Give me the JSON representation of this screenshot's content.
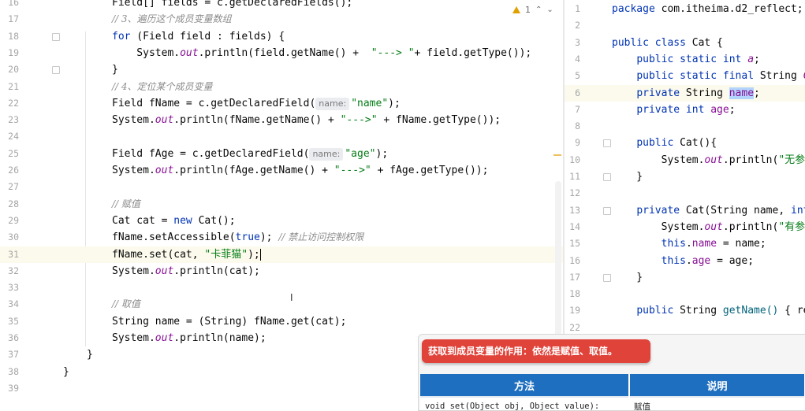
{
  "left_editor": {
    "warning_count": "1",
    "lines": [
      {
        "num": "16",
        "tokens": [
          {
            "t": "Field[] fields = c.getDeclaredFields();",
            "c": ""
          }
        ]
      },
      {
        "num": "17",
        "tokens": [
          {
            "t": "// 3、遍历这个成员变量数组",
            "c": "cm"
          }
        ]
      },
      {
        "num": "18",
        "tokens": [
          {
            "t": "for",
            "c": "kw"
          },
          {
            "t": " (Field field : fields) {",
            "c": ""
          }
        ]
      },
      {
        "num": "19",
        "tokens": [
          {
            "t": "    System.",
            "c": ""
          },
          {
            "t": "out",
            "c": "stat"
          },
          {
            "t": ".println(field.getName() +  ",
            "c": ""
          },
          {
            "t": "\"---> \"",
            "c": "st"
          },
          {
            "t": "+ field.getType());",
            "c": ""
          }
        ]
      },
      {
        "num": "20",
        "tokens": [
          {
            "t": "}",
            "c": ""
          }
        ]
      },
      {
        "num": "21",
        "tokens": [
          {
            "t": "// 4、定位某个成员变量",
            "c": "cm"
          }
        ]
      },
      {
        "num": "22",
        "tokens": [
          {
            "t": "Field fName = c.getDeclaredField(",
            "c": ""
          },
          {
            "t": "name:",
            "c": "hint"
          },
          {
            "t": "\"name\"",
            "c": "st"
          },
          {
            "t": ");",
            "c": ""
          }
        ]
      },
      {
        "num": "23",
        "tokens": [
          {
            "t": "System.",
            "c": ""
          },
          {
            "t": "out",
            "c": "stat"
          },
          {
            "t": ".println(fName.getName() + ",
            "c": ""
          },
          {
            "t": "\"--->\"",
            "c": "st"
          },
          {
            "t": " + fName.getType());",
            "c": ""
          }
        ]
      },
      {
        "num": "24",
        "tokens": []
      },
      {
        "num": "25",
        "tokens": [
          {
            "t": "Field fAge = c.getDeclaredField(",
            "c": ""
          },
          {
            "t": "name:",
            "c": "hint"
          },
          {
            "t": "\"age\"",
            "c": "st"
          },
          {
            "t": ");",
            "c": ""
          }
        ]
      },
      {
        "num": "26",
        "tokens": [
          {
            "t": "System.",
            "c": ""
          },
          {
            "t": "out",
            "c": "stat"
          },
          {
            "t": ".println(fAge.getName() + ",
            "c": ""
          },
          {
            "t": "\"--->\"",
            "c": "st"
          },
          {
            "t": " + fAge.getType());",
            "c": ""
          }
        ]
      },
      {
        "num": "27",
        "tokens": []
      },
      {
        "num": "28",
        "tokens": [
          {
            "t": "// 赋值",
            "c": "cm"
          }
        ]
      },
      {
        "num": "29",
        "tokens": [
          {
            "t": "Cat cat = ",
            "c": ""
          },
          {
            "t": "new",
            "c": "kw"
          },
          {
            "t": " Cat();",
            "c": ""
          }
        ]
      },
      {
        "num": "30",
        "tokens": [
          {
            "t": "fName.setAccessible(",
            "c": ""
          },
          {
            "t": "true",
            "c": "kw"
          },
          {
            "t": "); ",
            "c": ""
          },
          {
            "t": "// 禁止访问控制权限",
            "c": "cm"
          }
        ]
      },
      {
        "num": "31",
        "tokens": [
          {
            "t": "fName.set(cat, ",
            "c": ""
          },
          {
            "t": "\"卡菲猫\"",
            "c": "st"
          },
          {
            "t": ");",
            "c": ""
          }
        ],
        "current": true
      },
      {
        "num": "32",
        "tokens": [
          {
            "t": "System.",
            "c": ""
          },
          {
            "t": "out",
            "c": "stat"
          },
          {
            "t": ".println(cat);",
            "c": ""
          }
        ]
      },
      {
        "num": "33",
        "tokens": []
      },
      {
        "num": "34",
        "tokens": [
          {
            "t": "// 取值",
            "c": "cm"
          }
        ]
      },
      {
        "num": "35",
        "tokens": [
          {
            "t": "String name = (String) fName.get(cat);",
            "c": ""
          }
        ]
      },
      {
        "num": "36",
        "tokens": [
          {
            "t": "System.",
            "c": ""
          },
          {
            "t": "out",
            "c": "stat"
          },
          {
            "t": ".println(name);",
            "c": ""
          }
        ]
      },
      {
        "num": "37",
        "tokens": [
          {
            "t": "}",
            "c": ""
          }
        ]
      },
      {
        "num": "38",
        "tokens": [
          {
            "t": "}",
            "c": ""
          }
        ]
      },
      {
        "num": "39",
        "tokens": []
      }
    ]
  },
  "right_editor": {
    "lines": [
      {
        "num": "1",
        "tokens": [
          {
            "t": "package",
            "c": "kw"
          },
          {
            "t": " com.itheima.d2_reflect;",
            "c": ""
          }
        ]
      },
      {
        "num": "2",
        "tokens": []
      },
      {
        "num": "3",
        "tokens": [
          {
            "t": "public class",
            "c": "kw"
          },
          {
            "t": " Cat {",
            "c": ""
          }
        ]
      },
      {
        "num": "4",
        "tokens": [
          {
            "t": "    ",
            "c": ""
          },
          {
            "t": "public static int",
            "c": "kw"
          },
          {
            "t": " ",
            "c": ""
          },
          {
            "t": "a",
            "c": "stat"
          },
          {
            "t": ";",
            "c": ""
          }
        ]
      },
      {
        "num": "5",
        "tokens": [
          {
            "t": "    ",
            "c": ""
          },
          {
            "t": "public static final",
            "c": "kw"
          },
          {
            "t": " String ",
            "c": ""
          },
          {
            "t": "C",
            "c": "stat"
          }
        ]
      },
      {
        "num": "6",
        "tokens": [
          {
            "t": "    ",
            "c": ""
          },
          {
            "t": "private",
            "c": "kw"
          },
          {
            "t": " String ",
            "c": ""
          },
          {
            "t": "name",
            "c": "fld sel"
          },
          {
            "t": ";",
            "c": ""
          }
        ],
        "current": true
      },
      {
        "num": "7",
        "tokens": [
          {
            "t": "    ",
            "c": ""
          },
          {
            "t": "private int",
            "c": "kw"
          },
          {
            "t": " ",
            "c": ""
          },
          {
            "t": "age",
            "c": "fld"
          },
          {
            "t": ";",
            "c": ""
          }
        ]
      },
      {
        "num": "8",
        "tokens": []
      },
      {
        "num": "9",
        "tokens": [
          {
            "t": "    ",
            "c": ""
          },
          {
            "t": "public",
            "c": "kw"
          },
          {
            "t": " Cat(){",
            "c": ""
          }
        ]
      },
      {
        "num": "10",
        "tokens": [
          {
            "t": "        System.",
            "c": ""
          },
          {
            "t": "out",
            "c": "stat"
          },
          {
            "t": ".println(",
            "c": ""
          },
          {
            "t": "\"无参",
            "c": "st"
          }
        ]
      },
      {
        "num": "11",
        "tokens": [
          {
            "t": "    }",
            "c": ""
          }
        ]
      },
      {
        "num": "12",
        "tokens": []
      },
      {
        "num": "13",
        "tokens": [
          {
            "t": "    ",
            "c": ""
          },
          {
            "t": "private",
            "c": "kw"
          },
          {
            "t": " Cat(String name, ",
            "c": ""
          },
          {
            "t": "int",
            "c": "kw"
          }
        ]
      },
      {
        "num": "14",
        "tokens": [
          {
            "t": "        System.",
            "c": ""
          },
          {
            "t": "out",
            "c": "stat"
          },
          {
            "t": ".println(",
            "c": ""
          },
          {
            "t": "\"有参",
            "c": "st"
          }
        ]
      },
      {
        "num": "15",
        "tokens": [
          {
            "t": "        ",
            "c": ""
          },
          {
            "t": "this",
            "c": "kw"
          },
          {
            "t": ".",
            "c": ""
          },
          {
            "t": "name",
            "c": "fld"
          },
          {
            "t": " = name;",
            "c": ""
          }
        ]
      },
      {
        "num": "16",
        "tokens": [
          {
            "t": "        ",
            "c": ""
          },
          {
            "t": "this",
            "c": "kw"
          },
          {
            "t": ".",
            "c": ""
          },
          {
            "t": "age",
            "c": "fld"
          },
          {
            "t": " = age;",
            "c": ""
          }
        ]
      },
      {
        "num": "17",
        "tokens": [
          {
            "t": "    }",
            "c": ""
          }
        ]
      },
      {
        "num": "18",
        "tokens": []
      },
      {
        "num": "19",
        "tokens": [
          {
            "t": "    ",
            "c": ""
          },
          {
            "t": "public",
            "c": "kw"
          },
          {
            "t": " String ",
            "c": ""
          },
          {
            "t": "getName()",
            "c": "cm-method"
          },
          {
            "t": " { re",
            "c": ""
          }
        ]
      },
      {
        "num": "22",
        "tokens": []
      }
    ]
  },
  "popup": {
    "badge": "获取到成员变量的作用：依然是赋值、取值。",
    "headers": [
      "方法",
      "说明"
    ],
    "rows": [
      {
        "method": "void set(Object obj, Object value):",
        "desc": "赋值"
      }
    ]
  },
  "colors": {
    "keyword": "#0033b3",
    "string": "#067d17",
    "field": "#871094",
    "comment": "#8c8c8c",
    "badge": "#e0433a",
    "table_header": "#1e6fbf"
  }
}
